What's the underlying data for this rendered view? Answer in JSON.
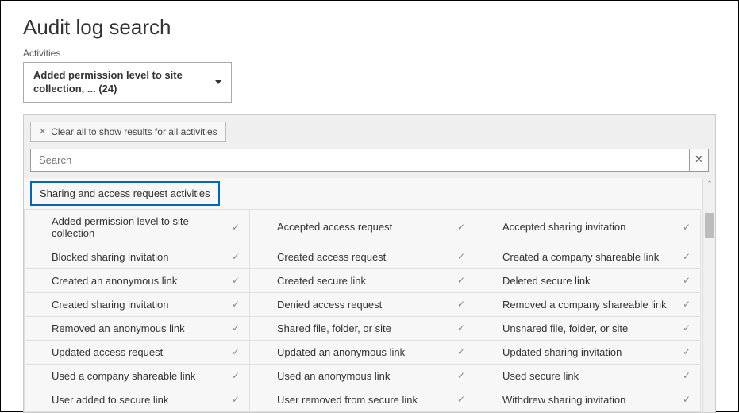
{
  "title": "Audit log search",
  "activities_label": "Activities",
  "dropdown": {
    "text": "Added permission level to site collection, ... (24)"
  },
  "clear_all": "Clear all to show results for all activities",
  "search": {
    "placeholder": "Search"
  },
  "category": "Sharing and access request activities",
  "grid": [
    [
      "Added permission level to site collection",
      "Accepted access request",
      "Accepted sharing invitation"
    ],
    [
      "Blocked sharing invitation",
      "Created access request",
      "Created a company shareable link"
    ],
    [
      "Created an anonymous link",
      "Created secure link",
      "Deleted secure link"
    ],
    [
      "Created sharing invitation",
      "Denied access request",
      "Removed a company shareable link"
    ],
    [
      "Removed an anonymous link",
      "Shared file, folder, or site",
      "Unshared file, folder, or site"
    ],
    [
      "Updated access request",
      "Updated an anonymous link",
      "Updated sharing invitation"
    ],
    [
      "Used a company shareable link",
      "Used an anonymous link",
      "Used secure link"
    ],
    [
      "User added to secure link",
      "User removed from secure link",
      "Withdrew sharing invitation"
    ]
  ]
}
